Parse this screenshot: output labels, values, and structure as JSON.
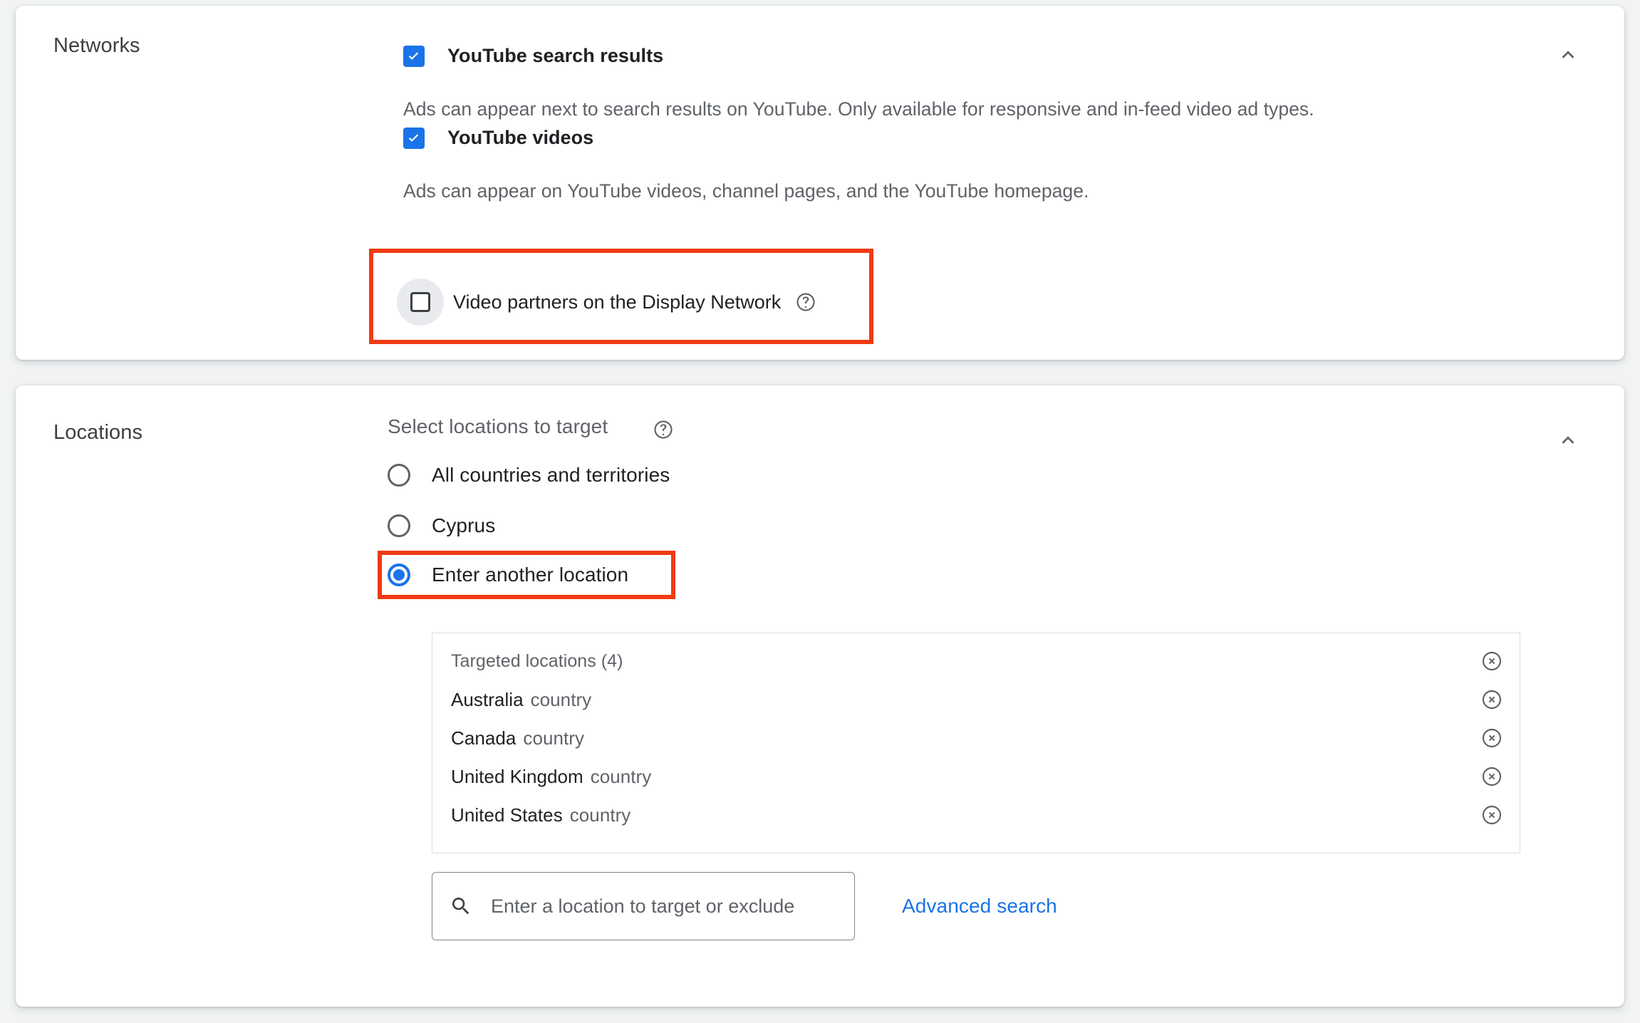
{
  "theme": {
    "page_bg": "#f1f3f4",
    "card_bg": "#ffffff",
    "accent_blue": "#1a73e8",
    "highlight_red": "#ee3b13",
    "text_primary": "#202124",
    "text_secondary": "#5f6368"
  },
  "networks": {
    "section_label": "Networks",
    "collapse_icon": "chevron-up-icon",
    "options": [
      {
        "label": "YouTube search results",
        "checked": true,
        "helper": "Ads can appear next to search results on YouTube. Only available for responsive and in-feed video ad types."
      },
      {
        "label": "YouTube videos",
        "checked": true,
        "helper": "Ads can appear on YouTube videos, channel pages, and the YouTube homepage."
      }
    ],
    "video_partners": {
      "label": "Video partners on the Display Network",
      "checked": false,
      "help_icon": "help-circle-icon",
      "highlighted": true
    }
  },
  "locations": {
    "section_label": "Locations",
    "collapse_icon": "chevron-up-icon",
    "subtitle": "Select locations to target",
    "subtitle_help_icon": "help-circle-icon",
    "radio_options": [
      {
        "label": "All countries and territories",
        "selected": false,
        "highlighted": false
      },
      {
        "label": "Cyprus",
        "selected": false,
        "highlighted": false
      },
      {
        "label": "Enter another location",
        "selected": true,
        "highlighted": true
      }
    ],
    "targeted_panel": {
      "header": "Targeted locations (4)",
      "header_remove_icon": "remove-circle-icon",
      "rows": [
        {
          "name": "Australia",
          "type": "country",
          "remove_icon": "remove-circle-icon"
        },
        {
          "name": "Canada",
          "type": "country",
          "remove_icon": "remove-circle-icon"
        },
        {
          "name": "United Kingdom",
          "type": "country",
          "remove_icon": "remove-circle-icon"
        },
        {
          "name": "United States",
          "type": "country",
          "remove_icon": "remove-circle-icon"
        }
      ]
    },
    "search": {
      "icon": "search-icon",
      "placeholder": "Enter a location to target or exclude",
      "value": ""
    },
    "advanced_search_label": "Advanced search"
  }
}
